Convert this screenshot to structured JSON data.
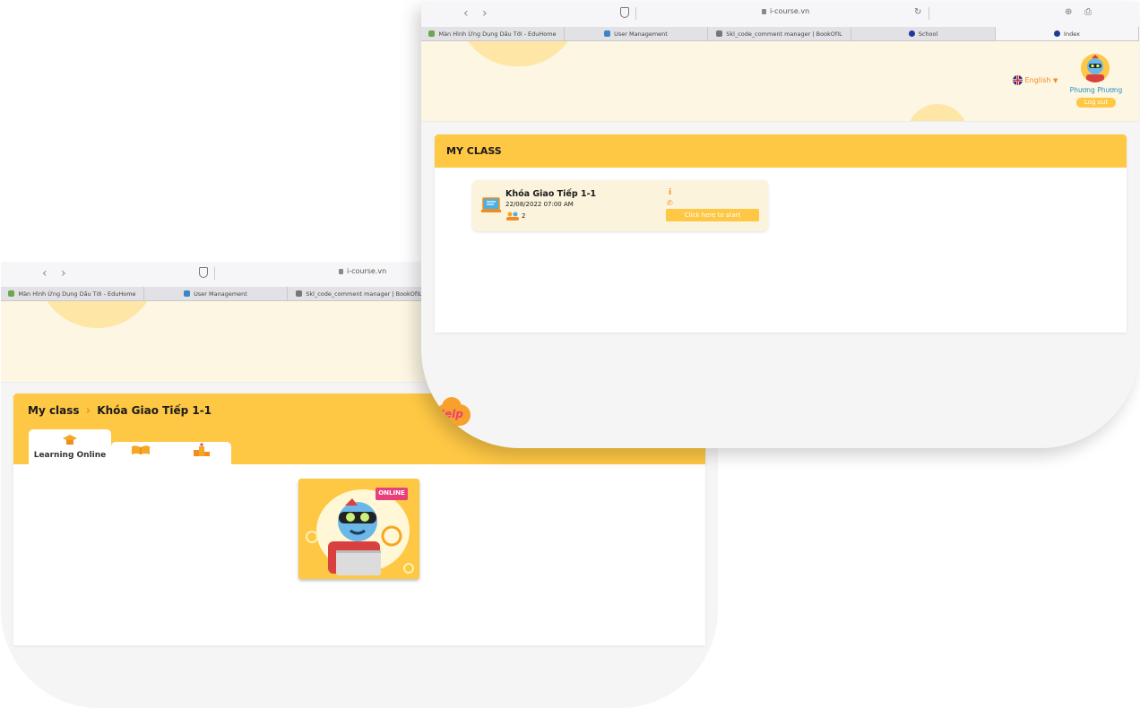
{
  "back_window": {
    "address": "i-course.vn",
    "tabs": [
      {
        "label": "Màn Hình Ứng Dụng Dấu Tới - EduHome",
        "favicon_color": "#6aa84f",
        "active": false
      },
      {
        "label": "User Management",
        "favicon_color": "#3d85c6",
        "active": false
      },
      {
        "label": "Skl_code_comment manager | BookOfIL",
        "favicon_color": "#777777",
        "active": false
      }
    ],
    "breadcrumb": {
      "root": "My class",
      "separator": "›",
      "current": "Khóa Giao Tiếp 1-1"
    },
    "course_tabs": [
      {
        "label": "Learning Online",
        "icon": "graduation-cap-icon",
        "active": true
      },
      {
        "label": "",
        "icon": "open-book-icon",
        "active": false
      },
      {
        "label": "",
        "icon": "podium-icon",
        "active": false
      }
    ],
    "online_card": {
      "badge": "ONLINE",
      "image": "robot-with-laptop-illustration"
    }
  },
  "front_window": {
    "address": "i-course.vn",
    "tabs": [
      {
        "label": "Màn Hình Ứng Dụng Dấu Tới - EduHome",
        "favicon_color": "#6aa84f",
        "active": false
      },
      {
        "label": "User Management",
        "favicon_color": "#3d85c6",
        "active": false
      },
      {
        "label": "Skl_code_comment manager | BookOfIL",
        "favicon_color": "#777777",
        "active": false
      },
      {
        "label": "School",
        "favicon_color": "#1f3a93",
        "active": false
      },
      {
        "label": "Index",
        "favicon_color": "#1f3a93",
        "active": true
      }
    ],
    "language": {
      "label": "English",
      "icon": "uk-flag-icon"
    },
    "user": {
      "name": "Phương Phương",
      "logout_label": "Log out",
      "avatar": "robot-avatar"
    },
    "section_title": "MY CLASS",
    "class_card": {
      "title": "Khóa Giao Tiếp 1-1",
      "datetime": "22/08/2022 07:00 AM",
      "students_count": "2",
      "start_label": "Click here to start",
      "info_icon": "info-icon",
      "phone_icon": "phone-icon"
    },
    "help_label": "Help"
  },
  "colors": {
    "accent": "#fec744",
    "accent_dark": "#f8a02a",
    "banner_bg": "#fdf6e2",
    "card_bg": "#fbf3dc",
    "help_text": "#e8407a",
    "user_name": "#2a8fbf"
  }
}
